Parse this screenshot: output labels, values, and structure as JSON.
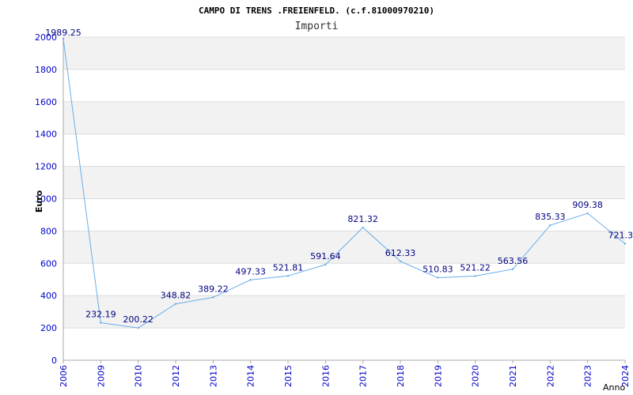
{
  "chart_data": {
    "type": "line",
    "title": "CAMPO DI TRENS .FREIENFELD. (c.f.81000970210)",
    "subtitle": "Importi",
    "xlabel": "Anno",
    "ylabel": "Euro",
    "ylim": [
      0,
      2000
    ],
    "yticks": [
      "0",
      "200",
      "400",
      "600",
      "800",
      "1000",
      "1200",
      "1400",
      "1600",
      "1800",
      "2000"
    ],
    "categories": [
      "2006",
      "2009",
      "2010",
      "2012",
      "2013",
      "2014",
      "2015",
      "2016",
      "2017",
      "2018",
      "2019",
      "2020",
      "2021",
      "2022",
      "2023",
      "2024"
    ],
    "series": [
      {
        "values": [
          1989.25,
          232.19,
          200.22,
          348.82,
          389.22,
          497.33,
          521.81,
          591.64,
          821.32,
          612.33,
          510.83,
          521.22,
          563.56,
          835.33,
          909.38,
          721.3
        ],
        "labels": [
          "1989.25",
          "232.19",
          "200.22",
          "348.82",
          "389.22",
          "497.33",
          "521.81",
          "591.64",
          "821.32",
          "612.33",
          "510.83",
          "521.22",
          "563.56",
          "835.33",
          "909.38",
          "721.3"
        ]
      }
    ],
    "grid": true,
    "colors": {
      "line": "#6aaee8",
      "tick_text": "#0000cc",
      "label_text": "#000080",
      "band": "#f2f2f2",
      "gridline": "#dddddd"
    }
  }
}
